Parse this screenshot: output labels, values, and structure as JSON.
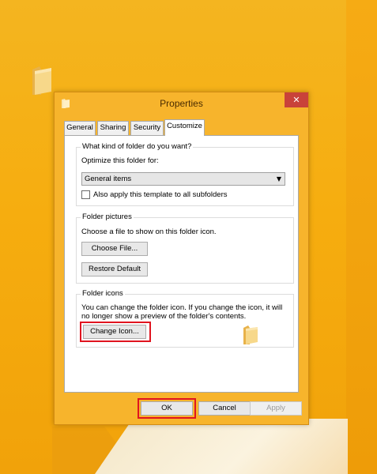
{
  "window": {
    "title": "Properties",
    "close_symbol": "✕",
    "tabs": [
      "General",
      "Sharing",
      "Security",
      "Customize"
    ],
    "active_tab": "Customize"
  },
  "customize": {
    "folder_type": {
      "group_title": "What kind of folder do you want?",
      "optimize_label": "Optimize this folder for:",
      "selected_option": "General items",
      "apply_subfolders_label": "Also apply this template to all subfolders",
      "apply_subfolders_checked": false
    },
    "folder_pictures": {
      "group_title": "Folder pictures",
      "description": "Choose a file to show on this folder icon.",
      "choose_file_label": "Choose File...",
      "restore_default_label": "Restore Default"
    },
    "folder_icons": {
      "group_title": "Folder icons",
      "description_line1": "You can change the folder icon. If you change the icon, it will",
      "description_line2": "no longer show a preview of the folder's contents.",
      "change_icon_label": "Change Icon..."
    }
  },
  "footer": {
    "ok_label": "OK",
    "cancel_label": "Cancel",
    "apply_label": "Apply"
  },
  "colors": {
    "highlight": "#e0141f",
    "close_button": "#c9423a",
    "window_frame": "#f7b42c"
  }
}
